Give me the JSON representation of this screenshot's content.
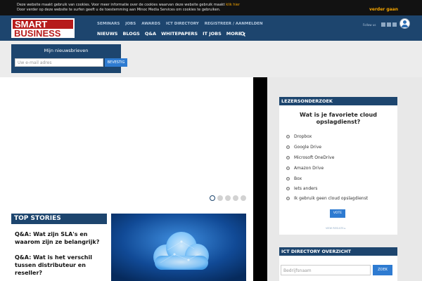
{
  "cookie": {
    "line1": "Deze website maakt gebruik van cookies. Voor meer informatie over de cookies waarvan deze website gebruik maakt ",
    "link": "klik hier",
    "line2": "Door verder op deze website te surfen geeft u de toestemming aan Minoc Media Services om cookies te gebruiken.",
    "continue": "verder gaan"
  },
  "logo": {
    "line1": "SMART",
    "line2": "BUSINESS"
  },
  "topnav": [
    "SEMINARS",
    "JOBS",
    "AWARDS",
    "ICT DIRECTORY",
    "REGISTREER / AANMELDEN"
  ],
  "mainnav": [
    "NIEUWS",
    "BLOGS",
    "Q&A",
    "WHITEPAPERS",
    "IT JOBS",
    "MORE ▾"
  ],
  "follow": "Follow us",
  "newsletter": {
    "title": "Mijn nieuwsbrieven",
    "placeholder": "Uw e-mail adres",
    "button": "BEVESTIG"
  },
  "slider": {
    "dots": 5,
    "active": 0
  },
  "poll": {
    "header": "LEZERSONDERZOEK",
    "question": "Wat is je favoriete cloud opslagdienst?",
    "options": [
      "Dropbox",
      "Google Drive",
      "Microsoft OneDrive",
      "Amazon Drive",
      "Box",
      "Iets anders",
      "Ik gebruik geen cloud opslagdienst"
    ],
    "vote": "VOTE",
    "results": "VIEW RESULTS ▸"
  },
  "ict": {
    "header": "ICT DIRECTORY OVERZICHT",
    "placeholder": "Bedrijfsnaam",
    "button": "ZOEK"
  },
  "stories": {
    "header": "TOP STORIES",
    "items": [
      "Q&A: Wat zijn SLA's en waarom zijn ze belangrijk?",
      "Q&A: Wat is het verschil tussen distributeur en reseller?"
    ]
  },
  "colors": {
    "navy": "#1d456e",
    "accent": "#2e7bd1",
    "cookie_link": "#f3a400",
    "logo_red": "#b61b1b"
  }
}
